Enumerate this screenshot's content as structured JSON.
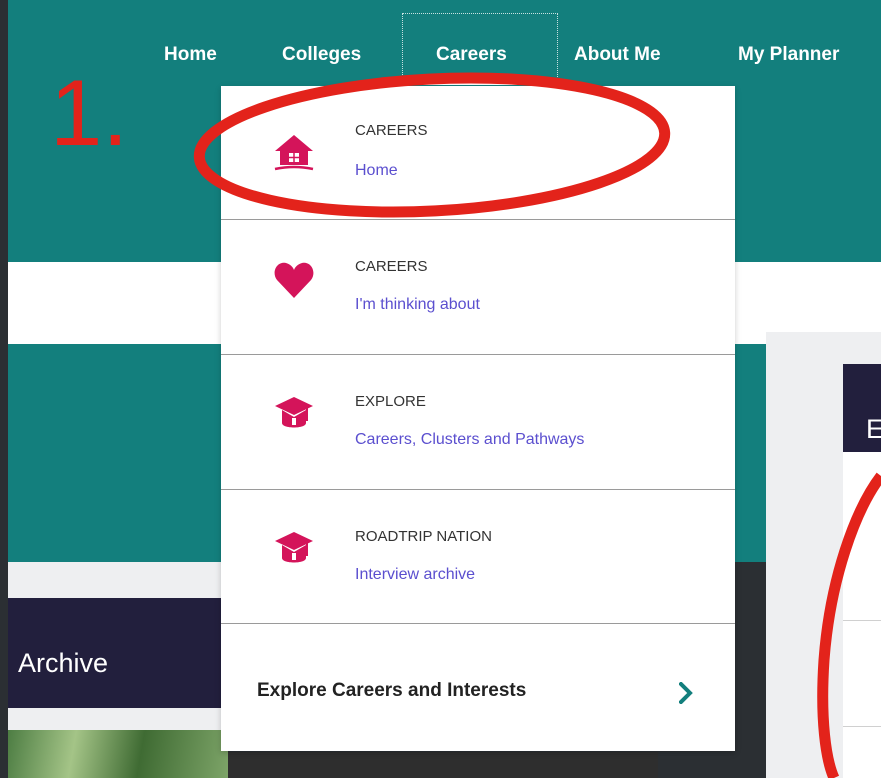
{
  "nav": {
    "items": [
      "Home",
      "Colleges",
      "Careers",
      "About Me",
      "My Planner"
    ],
    "active": "Careers"
  },
  "dropdown": {
    "items": [
      {
        "eyebrow": "CAREERS",
        "label": "Home",
        "icon": "house-icon"
      },
      {
        "eyebrow": "CAREERS",
        "label": "I'm thinking about",
        "icon": "heart-icon"
      },
      {
        "eyebrow": "EXPLORE",
        "label": "Careers, Clusters and Pathways",
        "icon": "graduation-cap-icon"
      },
      {
        "eyebrow": "ROADTRIP NATION",
        "label": "Interview archive",
        "icon": "graduation-cap-icon"
      }
    ],
    "footer_label": "Explore Careers and Interests",
    "footer_icon": "chevron-right-icon"
  },
  "background": {
    "left_heading": "Archive",
    "right_tab_letter": "E"
  },
  "annotation": {
    "step_label": "1."
  },
  "colors": {
    "teal": "#137f7d",
    "accent_pink": "#d4145a",
    "link_purple": "#5b4fcf",
    "annotation_red": "#e3231b",
    "dark_navy": "#221f3d"
  }
}
